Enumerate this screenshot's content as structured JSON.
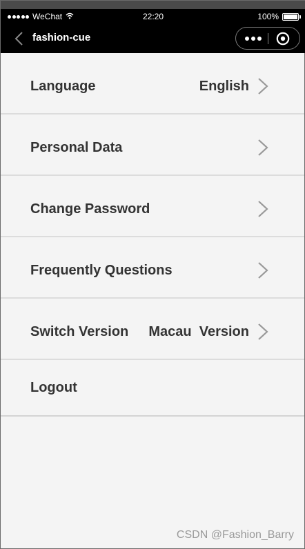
{
  "status_bar": {
    "carrier": "WeChat",
    "time": "22:20",
    "battery": "100%"
  },
  "nav": {
    "title": "fashion-cue"
  },
  "settings": [
    {
      "label": "Language",
      "value": "English"
    },
    {
      "label": "Personal Data",
      "value": ""
    },
    {
      "label": "Change Password",
      "value": ""
    },
    {
      "label": "Frequently Questions",
      "value": ""
    },
    {
      "label": "Switch Version",
      "value": "Macau  Version"
    },
    {
      "label": "Logout"
    }
  ],
  "watermark": "CSDN @Fashion_Barry"
}
